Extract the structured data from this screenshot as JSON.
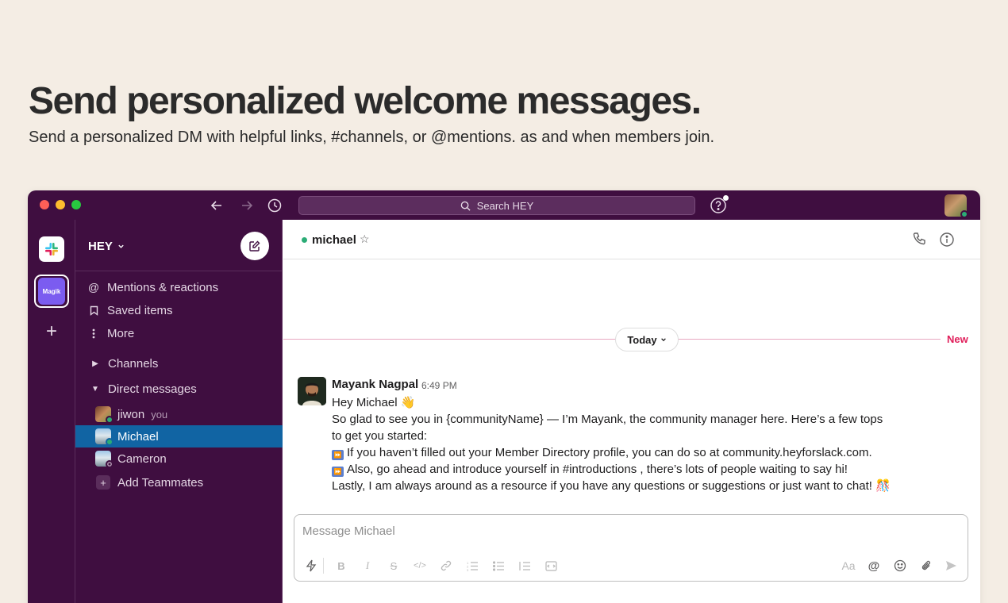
{
  "hero": {
    "title": "Send personalized welcome messages.",
    "subtitle": "Send a personalized DM with helpful links, #channels, or @mentions. as and when members join."
  },
  "titlebar": {
    "search_placeholder": "Search HEY",
    "icons": [
      "back-arrow-icon",
      "forward-arrow-icon",
      "history-icon",
      "search-icon",
      "help-icon"
    ]
  },
  "rail": {
    "workspace_label": "Magik"
  },
  "sidebar": {
    "workspace_name": "HEY",
    "items": [
      {
        "label": "Mentions & reactions",
        "icon": "at-icon"
      },
      {
        "label": "Saved items",
        "icon": "bookmark-icon"
      },
      {
        "label": "More",
        "icon": "more-vertical-icon"
      }
    ],
    "channels_label": "Channels",
    "dm_label": "Direct messages",
    "dms": [
      {
        "name": "jiwon",
        "suffix": "you"
      },
      {
        "name": "Michael"
      },
      {
        "name": "Cameron"
      }
    ],
    "add_teammates": "Add Teammates"
  },
  "channel": {
    "name": "michael"
  },
  "divider": {
    "today": "Today",
    "new": "New"
  },
  "message": {
    "author": "Mayank Nagpal",
    "time": "6:49 PM",
    "lines": [
      "Hey Michael 👋",
      "So glad to see you in {communityName} — I’m Mayank, the community manager here. Here’s a few tops",
      "to get you started:",
      "If you haven’t filled out your Member Directory profile, you can do so at community.heyforslack.com.",
      "Also, go ahead and introduce yourself in #introductions  , there’s lots of people waiting to say hi!",
      "Lastly, I am always around as a resource if you have any questions or suggestions or just want to chat! 🎊"
    ]
  },
  "composer": {
    "placeholder": "Message Michael",
    "format_label": "Aa"
  },
  "colors": {
    "aubergine": "#3f0e40",
    "active_blue": "#1164a3",
    "online_green": "#2bac76",
    "new_red": "#e01e5a",
    "page_bg": "#f4ede4"
  }
}
